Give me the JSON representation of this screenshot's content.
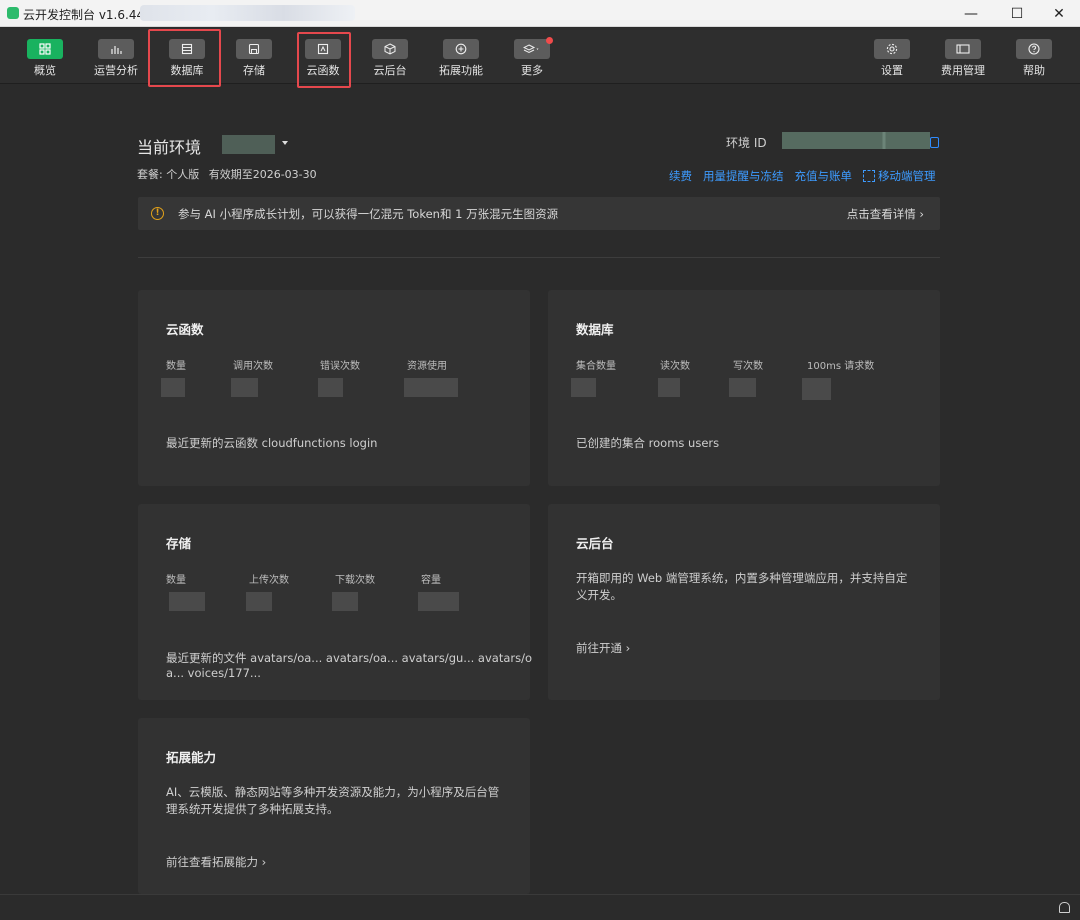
{
  "window": {
    "title": "云开发控制台 v1.6.44",
    "controls": {
      "minimize": "—",
      "maximize": "☐",
      "close": "✕"
    }
  },
  "toolbar": {
    "left": [
      {
        "label": "概览",
        "icon": "grid-icon",
        "active": true
      },
      {
        "label": "运营分析",
        "icon": "bar-chart-icon"
      },
      {
        "label": "数据库",
        "icon": "database-icon",
        "highlighted": true
      },
      {
        "label": "存储",
        "icon": "save-icon"
      },
      {
        "label": "云函数",
        "icon": "function-icon",
        "highlighted": true
      },
      {
        "label": "云后台",
        "icon": "box-icon"
      },
      {
        "label": "拓展功能",
        "icon": "plus-circle-icon"
      },
      {
        "label": "更多",
        "icon": "layers-icon",
        "badge": true
      }
    ],
    "right": [
      {
        "label": "设置",
        "icon": "gear-icon"
      },
      {
        "label": "费用管理",
        "icon": "billing-icon"
      },
      {
        "label": "帮助",
        "icon": "help-icon"
      }
    ]
  },
  "header": {
    "env_label": "当前环境",
    "env_id_label": "环境 ID",
    "plan_label": "套餐: 个人版",
    "expiry": "有效期至2026-03-30",
    "links": [
      "续费",
      "用量提醒与冻结",
      "充值与账单",
      "移动端管理"
    ]
  },
  "banner": {
    "text": "参与 AI 小程序成长计划，可以获得一亿混元 Token和 1 万张混元生图资源",
    "link": "点击查看详情 ›"
  },
  "cards": {
    "functions": {
      "title": "云函数",
      "stats": [
        "数量",
        "调用次数",
        "错误次数",
        "资源使用"
      ],
      "footer": "最近更新的云函数  cloudfunctions login"
    },
    "database": {
      "title": "数据库",
      "stats": [
        "集合数量",
        "读次数",
        "写次数",
        "100ms 请求数"
      ],
      "footer": "已创建的集合  rooms users"
    },
    "storage": {
      "title": "存储",
      "stats": [
        "数量",
        "上传次数",
        "下载次数",
        "容量"
      ],
      "footer_line1": "最近更新的文件  avatars/oa...  avatars/oa...  avatars/gu...  avatars/o",
      "footer_line2": "a...  voices/177..."
    },
    "backend": {
      "title": "云后台",
      "desc": "开箱即用的 Web 端管理系统，内置多种管理端应用，并支持自定义开发。",
      "link": "前往开通 ›"
    },
    "extensions": {
      "title": "拓展能力",
      "desc": "AI、云模版、静态网站等多种开发资源及能力，为小程序及后台管理系统开发提供了多种拓展支持。",
      "link": "前往查看拓展能力 ›"
    }
  }
}
